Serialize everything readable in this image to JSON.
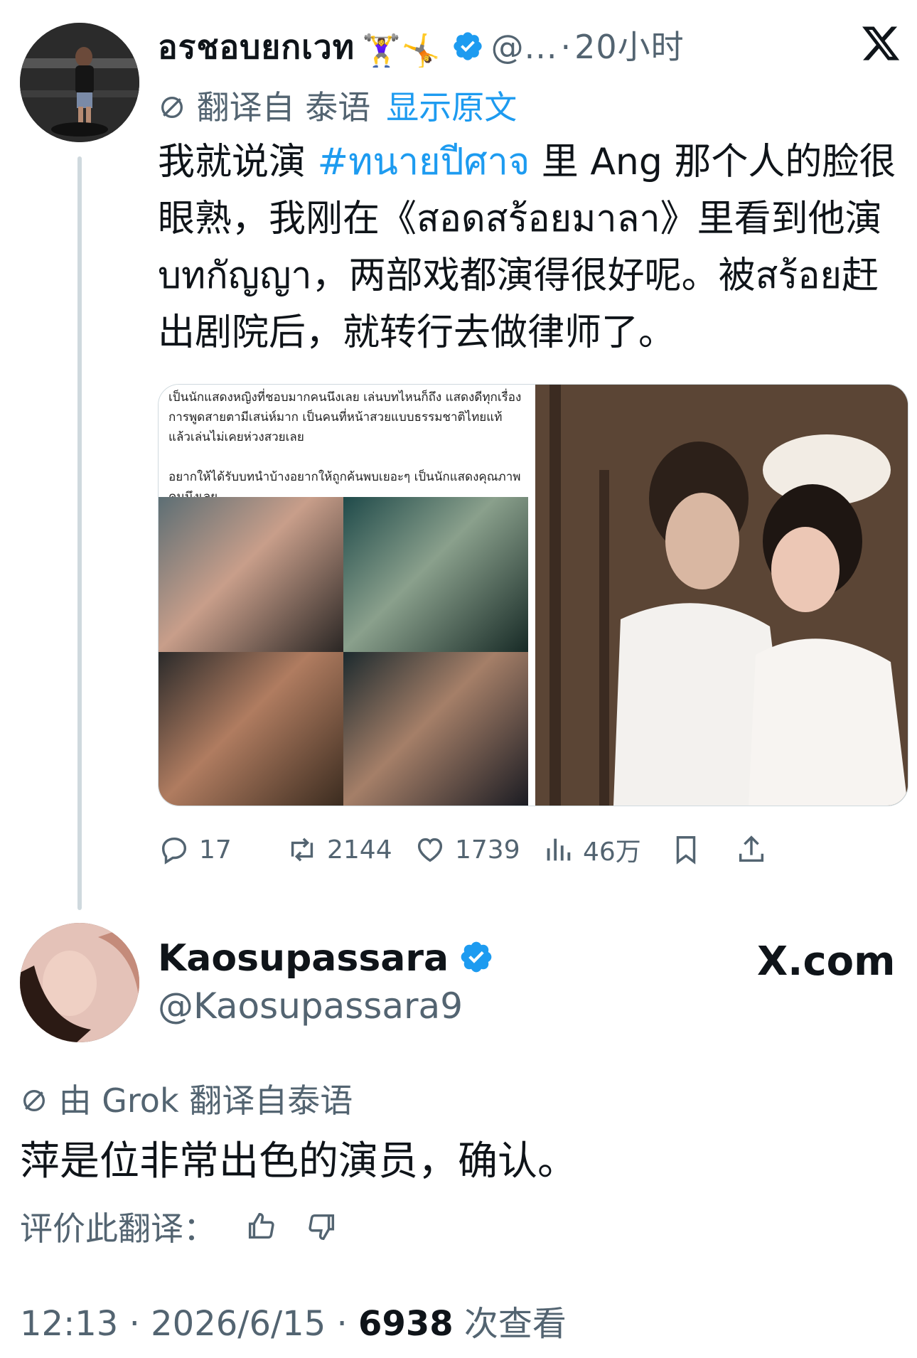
{
  "tweet": {
    "author_name": "อรชอบยกเวท",
    "author_emoji": "🏋️‍♀️🤸",
    "author_handle": "@...",
    "time_sep": "·",
    "time": "20小时",
    "translated_from": "翻译自 泰语",
    "show_original": "显示原文",
    "text_part1": "我就说演 ",
    "hashtag": "#ทนายปีศาจ",
    "text_part2": " 里 Ang 那个人的脸很眼熟，我刚在《สอดสร้อยมาลา》里看到他演บทกัญญา，两部戏都演得很好呢。被สร้อย赶出剧院后，就转行去做律师了。",
    "media_caption": "เป็นนักแสดงหญิงที่ชอบมากคนนึงเลย เล่นบทไหนก็ถึง แสดงดีทุกเรื่อง การพูดสายตามีเสน่ห์มาก เป็นคนที่หน้าสวยแบบธรรมชาติไทยแท้ แล้วเล่นไม่เคยห่วงสวยเลย\n\nอยากให้ได้รับบทนำบ้างอยากให้ถูกค้นพบเยอะๆ เป็นนักแสดงคุณภาพคนนึงเลย",
    "actions": {
      "replies": "17",
      "reposts": "2144",
      "likes": "1739",
      "views": "46万"
    }
  },
  "reply": {
    "author_name": "Kaosupassara",
    "author_handle": "@Kaosupassara9",
    "site": "X.com",
    "translated_by": "由 Grok 翻译自泰语",
    "text": "萍是位非常出色的演员，确认。",
    "rate_label": "评价此翻译：",
    "time": "12:13",
    "date": "2026/6/15",
    "views_count": "6938",
    "views_label": "次查看",
    "sep": "·"
  },
  "colors": {
    "link": "#1d9bf0",
    "muted": "#536471",
    "text": "#0f1419"
  },
  "icons": [
    "x-logo-icon",
    "verified-icon",
    "translate-icon",
    "reply-icon",
    "repost-icon",
    "like-icon",
    "views-icon",
    "bookmark-icon",
    "share-icon",
    "thumbs-up-icon",
    "thumbs-down-icon"
  ]
}
